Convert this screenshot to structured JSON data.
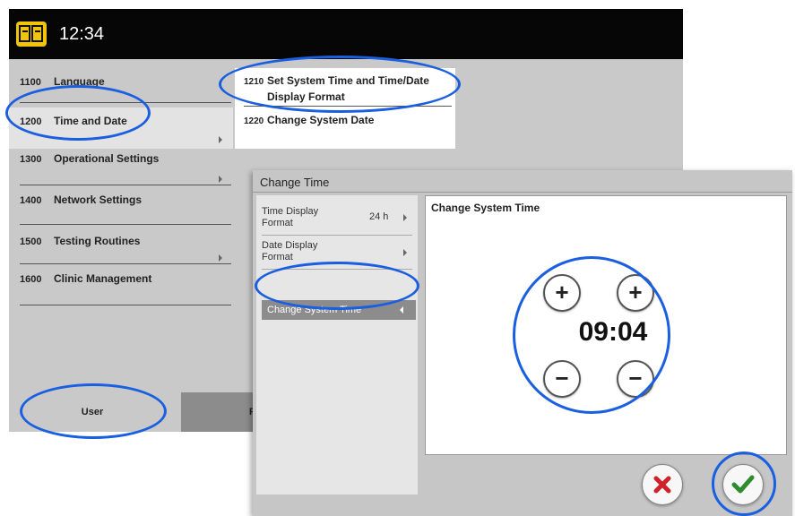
{
  "topbar": {
    "time": "12:34",
    "logo_icon": "device-logo-icon"
  },
  "menu": {
    "items": [
      {
        "num": "1100",
        "label": "Language"
      },
      {
        "num": "1200",
        "label": "Time and Date"
      },
      {
        "num": "1300",
        "label": "Operational Settings"
      },
      {
        "num": "1400",
        "label": "Network Settings"
      },
      {
        "num": "1500",
        "label": "Testing Routines"
      },
      {
        "num": "1600",
        "label": "Clinic Management"
      }
    ]
  },
  "submenu": {
    "items": [
      {
        "num": "1210",
        "label_line1": "Set System Time and Time/Date",
        "label_line2": "Display Format"
      },
      {
        "num": "1220",
        "label_line1": "Change System Date"
      }
    ]
  },
  "tabs": {
    "user": "User",
    "other": "Pr"
  },
  "dialog": {
    "title": "Change Time",
    "left_items": [
      {
        "label_line1": "Time Display",
        "label_line2": "Format",
        "value": "24 h"
      },
      {
        "label_line1": "Date Display",
        "label_line2": "Format"
      },
      {
        "label_line1": "Change System Time"
      }
    ],
    "right_title": "Change System Time",
    "time_value": "09:04",
    "plus_symbol": "+",
    "minus_symbol": "−"
  },
  "colors": {
    "highlight": "#1a5fe0",
    "cancel": "#d0202a",
    "confirm": "#2e8b2e",
    "logo": "#f2c50d"
  }
}
